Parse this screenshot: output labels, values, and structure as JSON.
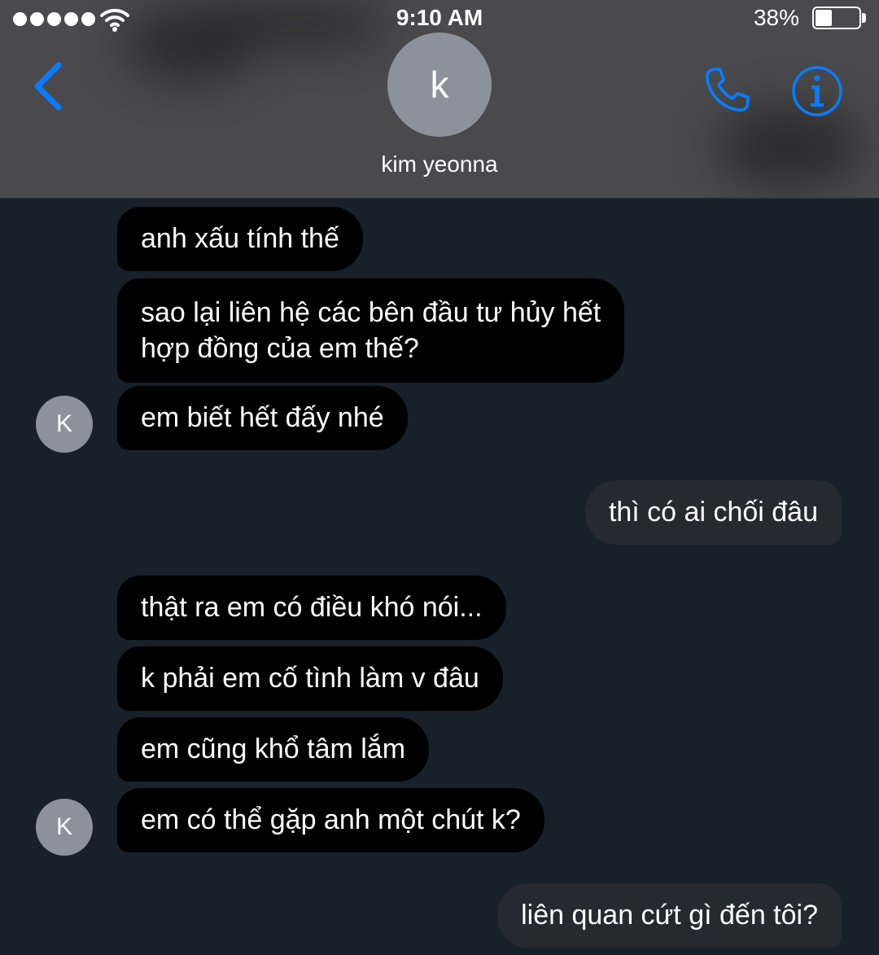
{
  "status_bar": {
    "time": "9:10 AM",
    "battery_percent": "38%",
    "battery_level": 0.38,
    "signal_dots": 5,
    "signal_icon": "signal-dots-icon",
    "wifi_icon": "wifi-icon"
  },
  "header": {
    "back_icon": "chevron-left-icon",
    "avatar_letter": "k",
    "contact_name": "kim yeonna",
    "call_icon": "phone-icon",
    "info_icon": "info-icon"
  },
  "messages": [
    {
      "sender": "them",
      "text": "anh xấu tính thế"
    },
    {
      "sender": "them",
      "text": "sao lại liên hệ các bên đầu tư hủy hết\nhợp đồng của em thế?"
    },
    {
      "sender": "them",
      "text": "em biết hết đấy nhé",
      "avatar": "K"
    },
    {
      "sender": "me",
      "text": "thì có ai chối đâu"
    },
    {
      "sender": "them",
      "text": "thật ra em có điều khó nói..."
    },
    {
      "sender": "them",
      "text": "k phải em cố tình làm v đâu"
    },
    {
      "sender": "them",
      "text": "em cũng khổ tâm lắm"
    },
    {
      "sender": "them",
      "text": "em có thể gặp anh một chút k?",
      "avatar": "K"
    },
    {
      "sender": "me",
      "text": "liên quan cứt gì đến tôi?"
    }
  ],
  "colors": {
    "header_bg": "#4a4a4c",
    "chat_bg": "#18202a",
    "incoming_bubble": "#000000",
    "outgoing_bubble": "#262930",
    "accent_blue": "#0a7bff",
    "avatar_gray": "#8c919c"
  }
}
